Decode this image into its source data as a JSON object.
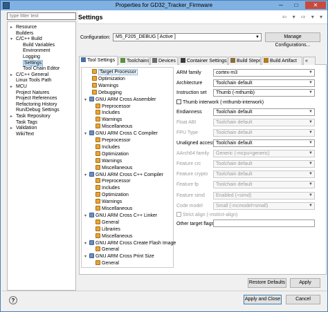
{
  "window": {
    "title": "Properties for GD32_Tracker_Firmware",
    "min_glyph": "─",
    "max_glyph": "□",
    "close_glyph": "✕"
  },
  "filter": {
    "placeholder": "type filter text"
  },
  "nav": {
    "items": [
      {
        "label": "Resource",
        "expander": "▸"
      },
      {
        "label": "Builders",
        "expander": ""
      },
      {
        "label": "C/C++ Build",
        "expander": "▾"
      },
      {
        "label": "Build Variables",
        "expander": ""
      },
      {
        "label": "Environment",
        "expander": ""
      },
      {
        "label": "Logging",
        "expander": ""
      },
      {
        "label": "Settings",
        "expander": ""
      },
      {
        "label": "Tool Chain Editor",
        "expander": ""
      },
      {
        "label": "C/C++ General",
        "expander": "▸"
      },
      {
        "label": "Linux Tools Path",
        "expander": ""
      },
      {
        "label": "MCU",
        "expander": "▸"
      },
      {
        "label": "Project Natures",
        "expander": ""
      },
      {
        "label": "Project References",
        "expander": ""
      },
      {
        "label": "Refactoring History",
        "expander": ""
      },
      {
        "label": "Run/Debug Settings",
        "expander": ""
      },
      {
        "label": "Task Repository",
        "expander": "▸"
      },
      {
        "label": "Task Tags",
        "expander": ""
      },
      {
        "label": "Validation",
        "expander": "▸"
      },
      {
        "label": "WikiText",
        "expander": ""
      }
    ]
  },
  "header": {
    "title": "Settings",
    "nav_glyphs": "⇦ ▾ ⇨ ▾ ▾"
  },
  "configuration": {
    "label": "Configuration:",
    "value": "M5_F205_DEBUG  [ Active ]",
    "manage_button": "Manage Configurations..."
  },
  "tabs": [
    {
      "label": "Tool Settings",
      "color": "#4a6fa5"
    },
    {
      "label": "Toolchains",
      "color": "#5a8f3c"
    },
    {
      "label": "Devices",
      "color": "#6b6b6b"
    },
    {
      "label": "Container Settings",
      "color": "#3a3a3a"
    },
    {
      "label": "Build Steps",
      "color": "#8a6d3b"
    },
    {
      "label": "Build Artifact",
      "color": "#b07a20"
    },
    {
      "label": "«",
      "color": ""
    }
  ],
  "tool_tree": [
    {
      "label": "Target Processor",
      "kind": "leaf",
      "expander": "",
      "indent": 1
    },
    {
      "label": "Optimization",
      "kind": "leaf",
      "expander": "",
      "indent": 1
    },
    {
      "label": "Warnings",
      "kind": "leaf",
      "expander": "",
      "indent": 1
    },
    {
      "label": "Debugging",
      "kind": "leaf",
      "expander": "",
      "indent": 1
    },
    {
      "label": "GNU ARM Cross Assembler",
      "kind": "grp",
      "expander": "▾",
      "indent": 0
    },
    {
      "label": "Preprocessor",
      "kind": "leaf",
      "expander": "",
      "indent": 2
    },
    {
      "label": "Includes",
      "kind": "leaf",
      "expander": "",
      "indent": 2
    },
    {
      "label": "Warnings",
      "kind": "leaf",
      "expander": "",
      "indent": 2
    },
    {
      "label": "Miscellaneous",
      "kind": "leaf",
      "expander": "",
      "indent": 2
    },
    {
      "label": "GNU ARM Cross C Compiler",
      "kind": "grp",
      "expander": "▾",
      "indent": 0
    },
    {
      "label": "Preprocessor",
      "kind": "leaf",
      "expander": "",
      "indent": 2
    },
    {
      "label": "Includes",
      "kind": "leaf",
      "expander": "",
      "indent": 2
    },
    {
      "label": "Optimization",
      "kind": "leaf",
      "expander": "",
      "indent": 2
    },
    {
      "label": "Warnings",
      "kind": "leaf",
      "expander": "",
      "indent": 2
    },
    {
      "label": "Miscellaneous",
      "kind": "leaf",
      "expander": "",
      "indent": 2
    },
    {
      "label": "GNU ARM Cross C++ Compiler",
      "kind": "grp",
      "expander": "▾",
      "indent": 0
    },
    {
      "label": "Preprocessor",
      "kind": "leaf",
      "expander": "",
      "indent": 2
    },
    {
      "label": "Includes",
      "kind": "leaf",
      "expander": "",
      "indent": 2
    },
    {
      "label": "Optimization",
      "kind": "leaf",
      "expander": "",
      "indent": 2
    },
    {
      "label": "Warnings",
      "kind": "leaf",
      "expander": "",
      "indent": 2
    },
    {
      "label": "Miscellaneous",
      "kind": "leaf",
      "expander": "",
      "indent": 2
    },
    {
      "label": "GNU ARM Cross C++ Linker",
      "kind": "grp",
      "expander": "▾",
      "indent": 0
    },
    {
      "label": "General",
      "kind": "leaf",
      "expander": "",
      "indent": 2
    },
    {
      "label": "Libraries",
      "kind": "leaf",
      "expander": "",
      "indent": 2
    },
    {
      "label": "Miscellaneous",
      "kind": "leaf",
      "expander": "",
      "indent": 2
    },
    {
      "label": "GNU ARM Cross Create Flash Image",
      "kind": "grp",
      "expander": "▾",
      "indent": 0
    },
    {
      "label": "General",
      "kind": "leaf",
      "expander": "",
      "indent": 2
    },
    {
      "label": "GNU ARM Cross Print Size",
      "kind": "grp",
      "expander": "▾",
      "indent": 0
    },
    {
      "label": "General",
      "kind": "leaf",
      "expander": "",
      "indent": 2
    }
  ],
  "settings": {
    "arm_family": {
      "label": "ARM family",
      "value": "cortex-m3"
    },
    "architecture": {
      "label": "Architecture",
      "value": "Toolchain default"
    },
    "instruction_set": {
      "label": "Instruction set",
      "value": "Thumb (-mthumb)"
    },
    "thumb_interwork": {
      "label": "Thumb interwork (-mthumb-interwork)"
    },
    "endianness": {
      "label": "Endianness",
      "value": "Toolchain default"
    },
    "float_abi": {
      "label": "Float ABI",
      "value": "Toolchain default"
    },
    "fpu_type": {
      "label": "FPU Type",
      "value": "Toolchain default"
    },
    "unaligned_access": {
      "label": "Unaligned access",
      "value": "Toolchain default"
    },
    "aarch64_family": {
      "label": "AArch64 family",
      "value": "Generic (-mcpu=generic)"
    },
    "feature_crc": {
      "label": "Feature crc",
      "value": "Toolchain default"
    },
    "feature_crypto": {
      "label": "Feature crypto",
      "value": "Toolchain default"
    },
    "feature_fp": {
      "label": "Feature fp",
      "value": "Toolchain default"
    },
    "feature_simd": {
      "label": "Feature simd",
      "value": "Enabled (+simd)"
    },
    "code_model": {
      "label": "Code model",
      "value": "Small (-mcmodel=small)"
    },
    "strict_align": {
      "label": "Strict align (-mstrict-align)"
    },
    "other_target_flags": {
      "label": "Other target flags",
      "value": ""
    }
  },
  "buttons": {
    "restore_defaults": "Restore Defaults",
    "apply": "Apply",
    "apply_and_close": "Apply and Close",
    "cancel": "Cancel",
    "help": "?"
  },
  "colors": {
    "selection": "#cde8ff",
    "titlebar": "#7fb1e2",
    "close": "#c74a3f"
  }
}
